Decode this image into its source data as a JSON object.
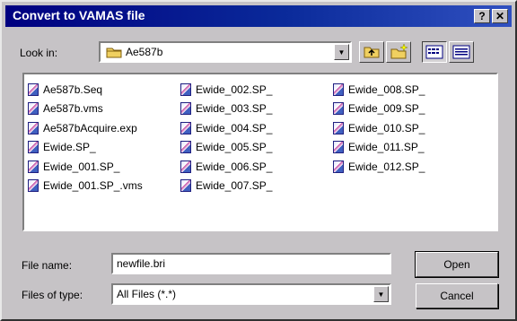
{
  "window": {
    "title": "Convert to VAMAS file",
    "help_glyph": "?",
    "close_glyph": "✕"
  },
  "lookin": {
    "label": "Look in:",
    "value": "Ae587b"
  },
  "files": {
    "col1": [
      "Ae587b.Seq",
      "Ae587b.vms",
      "Ae587bAcquire.exp",
      "Ewide.SP_",
      "Ewide_001.SP_",
      "Ewide_001.SP_.vms"
    ],
    "col2": [
      "Ewide_002.SP_",
      "Ewide_003.SP_",
      "Ewide_004.SP_",
      "Ewide_005.SP_",
      "Ewide_006.SP_",
      "Ewide_007.SP_"
    ],
    "col3": [
      "Ewide_008.SP_",
      "Ewide_009.SP_",
      "Ewide_010.SP_",
      "Ewide_011.SP_",
      "Ewide_012.SP_"
    ]
  },
  "filename": {
    "label": "File name:",
    "value": "newfile.bri"
  },
  "filetype": {
    "label": "Files of type:",
    "value": "All Files (*.*)"
  },
  "buttons": {
    "open": "Open",
    "cancel": "Cancel"
  }
}
